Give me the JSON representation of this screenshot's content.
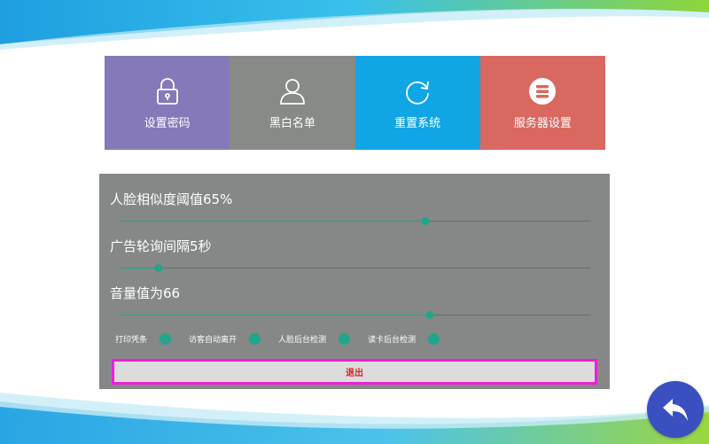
{
  "colors": {
    "tile_password": "#8579b9",
    "tile_blacklist": "#878a87",
    "tile_reset": "#10a6e6",
    "tile_server": "#d96861",
    "panel": "#858886",
    "accent": "#21a58d",
    "exit_border": "#ee1fd6",
    "exit_text": "#d9232a",
    "back_button": "#3a4fc0"
  },
  "tiles": [
    {
      "label": "设置密码",
      "icon": "lock-icon"
    },
    {
      "label": "黑白名单",
      "icon": "user-icon"
    },
    {
      "label": "重置系统",
      "icon": "refresh-icon"
    },
    {
      "label": "服务器设置",
      "icon": "server-icon"
    }
  ],
  "settings": {
    "face_threshold": {
      "label": "人脸相似度阈值65%",
      "value": 65,
      "fraction": 0.65
    },
    "ad_interval": {
      "label": "广告轮询间隔5秒",
      "value": 5,
      "fraction": 0.085
    },
    "volume": {
      "label": "音量值为66",
      "value": 66,
      "fraction": 0.66
    }
  },
  "toggles": [
    {
      "label": "打印凭条",
      "on": true
    },
    {
      "label": "访客自动离开",
      "on": true
    },
    {
      "label": "人脸后台检测",
      "on": true
    },
    {
      "label": "读卡后台检测",
      "on": true
    }
  ],
  "exit_label": "退出",
  "back_icon": "back-arrow-icon"
}
